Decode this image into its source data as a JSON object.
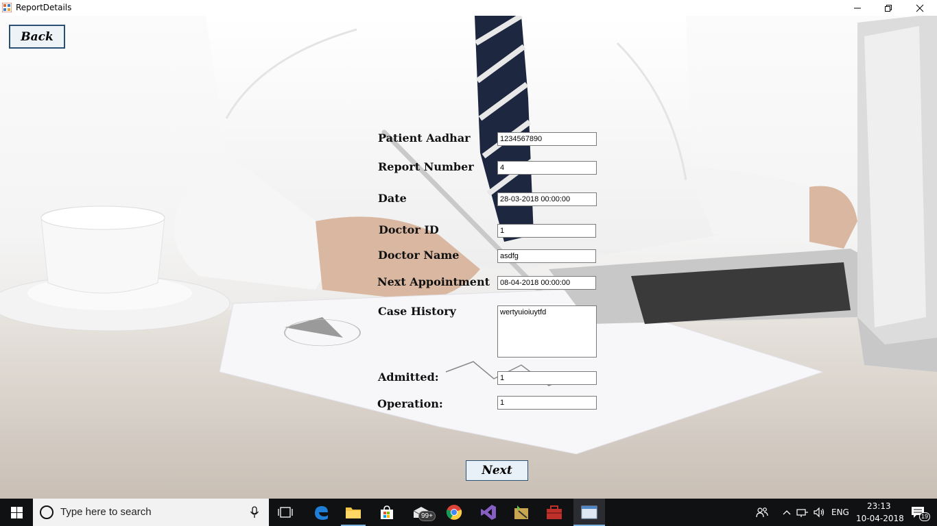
{
  "window": {
    "title": "ReportDetails"
  },
  "buttons": {
    "back": "Back",
    "next": "Next"
  },
  "form": {
    "fields": [
      {
        "id": "patient-aadhar",
        "label": "Patient Aadhar",
        "value": "1234567890"
      },
      {
        "id": "report-number",
        "label": "Report Number",
        "value": "4"
      },
      {
        "id": "date",
        "label": "Date",
        "value": "28-03-2018 00:00:00"
      },
      {
        "id": "doctor-id",
        "label": "Doctor ID",
        "value": "1"
      },
      {
        "id": "doctor-name",
        "label": "Doctor Name",
        "value": "asdfg"
      },
      {
        "id": "next-appointment",
        "label": "Next Appointment",
        "value": "08-04-2018 00:00:00"
      },
      {
        "id": "case-history",
        "label": "Case History",
        "value": "wertyuioiuytfd"
      },
      {
        "id": "admitted",
        "label": "Admitted:",
        "value": "1"
      },
      {
        "id": "operation",
        "label": "Operation:",
        "value": "1"
      }
    ]
  },
  "taskbar": {
    "search_placeholder": "Type here to search",
    "mail_badge": "99+",
    "language": "ENG",
    "time": "23:13",
    "date": "10-04-2018",
    "notification_count": "19"
  },
  "colors": {
    "button_border": "#2a4f74",
    "taskbar_bg": "#101113",
    "accent": "#7fb5e3"
  }
}
